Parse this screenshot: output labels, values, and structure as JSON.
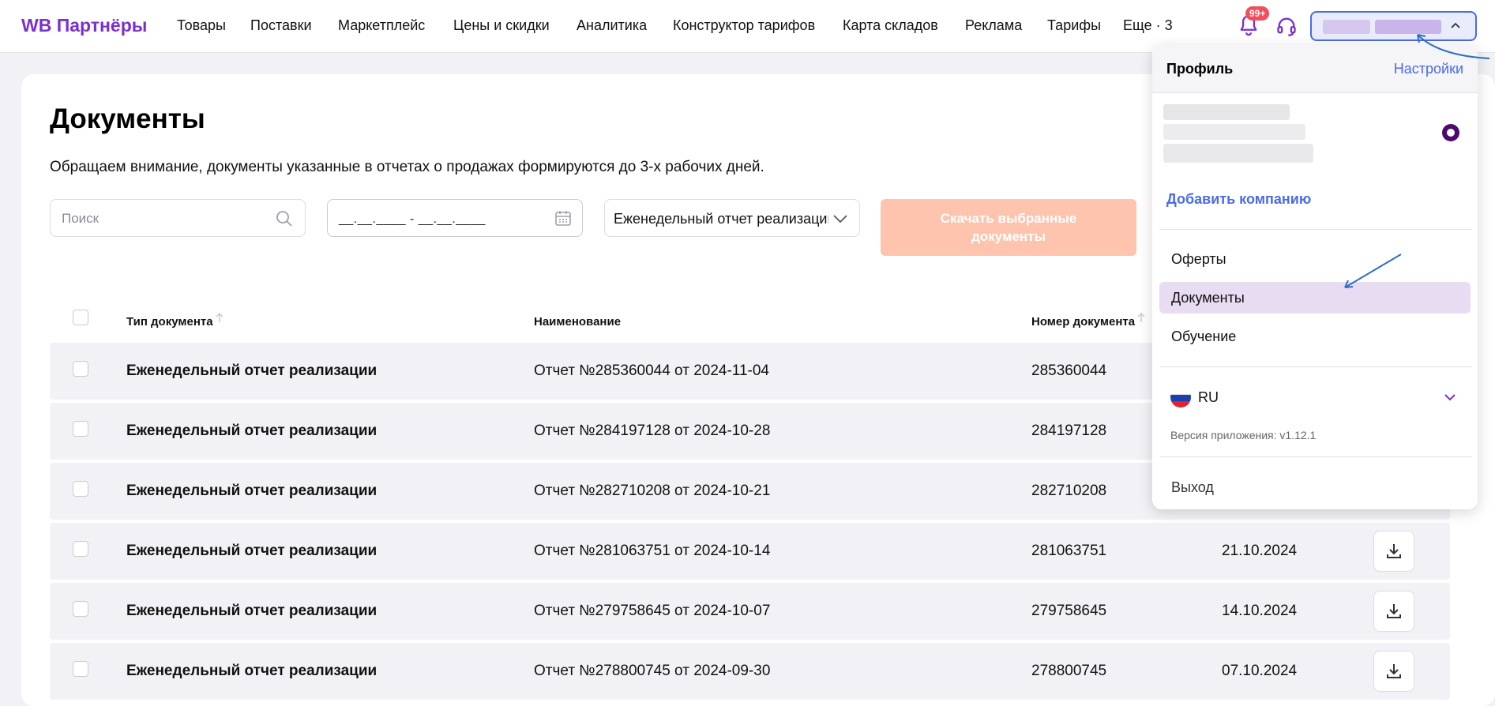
{
  "header": {
    "logo": "WB Партнёры",
    "nav": [
      "Товары",
      "Поставки",
      "Маркетплейс",
      "Цены и скидки",
      "Аналитика",
      "Конструктор тарифов",
      "Карта складов",
      "Реклама",
      "Тарифы",
      "Еще · 3"
    ],
    "notifications_badge": "99+",
    "icons": [
      "bell-icon",
      "headset-icon",
      "chevron-up-icon"
    ]
  },
  "page": {
    "title": "Документы",
    "notice": "Обращаем внимание, документы указанные в отчетах о продажах формируются до 3-х рабочих дней."
  },
  "filters": {
    "search_placeholder": "Поиск",
    "date_value": "__.__.____ - __.__.____",
    "type_value": "Еженедельный отчет реализации",
    "download_selected": "Скачать выбранные документы"
  },
  "table": {
    "headers": {
      "type": "Тип документа",
      "name": "Наименование",
      "number": "Номер документа"
    },
    "rows": [
      {
        "type": "Еженедельный отчет реализации",
        "name": "Отчет №285360044 от 2024-11-04",
        "number": "285360044",
        "date": ""
      },
      {
        "type": "Еженедельный отчет реализации",
        "name": "Отчет №284197128 от 2024-10-28",
        "number": "284197128",
        "date": ""
      },
      {
        "type": "Еженедельный отчет реализации",
        "name": "Отчет №282710208 от 2024-10-21",
        "number": "282710208",
        "date": ""
      },
      {
        "type": "Еженедельный отчет реализации",
        "name": "Отчет №281063751 от 2024-10-14",
        "number": "281063751",
        "date": "21.10.2024"
      },
      {
        "type": "Еженедельный отчет реализации",
        "name": "Отчет №279758645 от 2024-10-07",
        "number": "279758645",
        "date": "14.10.2024"
      },
      {
        "type": "Еженедельный отчет реализации",
        "name": "Отчет №278800745 от 2024-09-30",
        "number": "278800745",
        "date": "07.10.2024"
      }
    ]
  },
  "menu": {
    "title": "Профиль",
    "settings": "Настройки",
    "add_company": "Добавить компанию",
    "items": [
      "Оферты",
      "Документы",
      "Обучение"
    ],
    "active_item": "Документы",
    "language": "RU",
    "version": "Версия приложения: v1.12.1",
    "logout": "Выход"
  },
  "colors": {
    "brand": "#7b2fd0",
    "link": "#4a6be8",
    "download_disabled": "#ffc4ae",
    "active_menu": "#e7dcf2",
    "badge": "#f04f5b"
  }
}
